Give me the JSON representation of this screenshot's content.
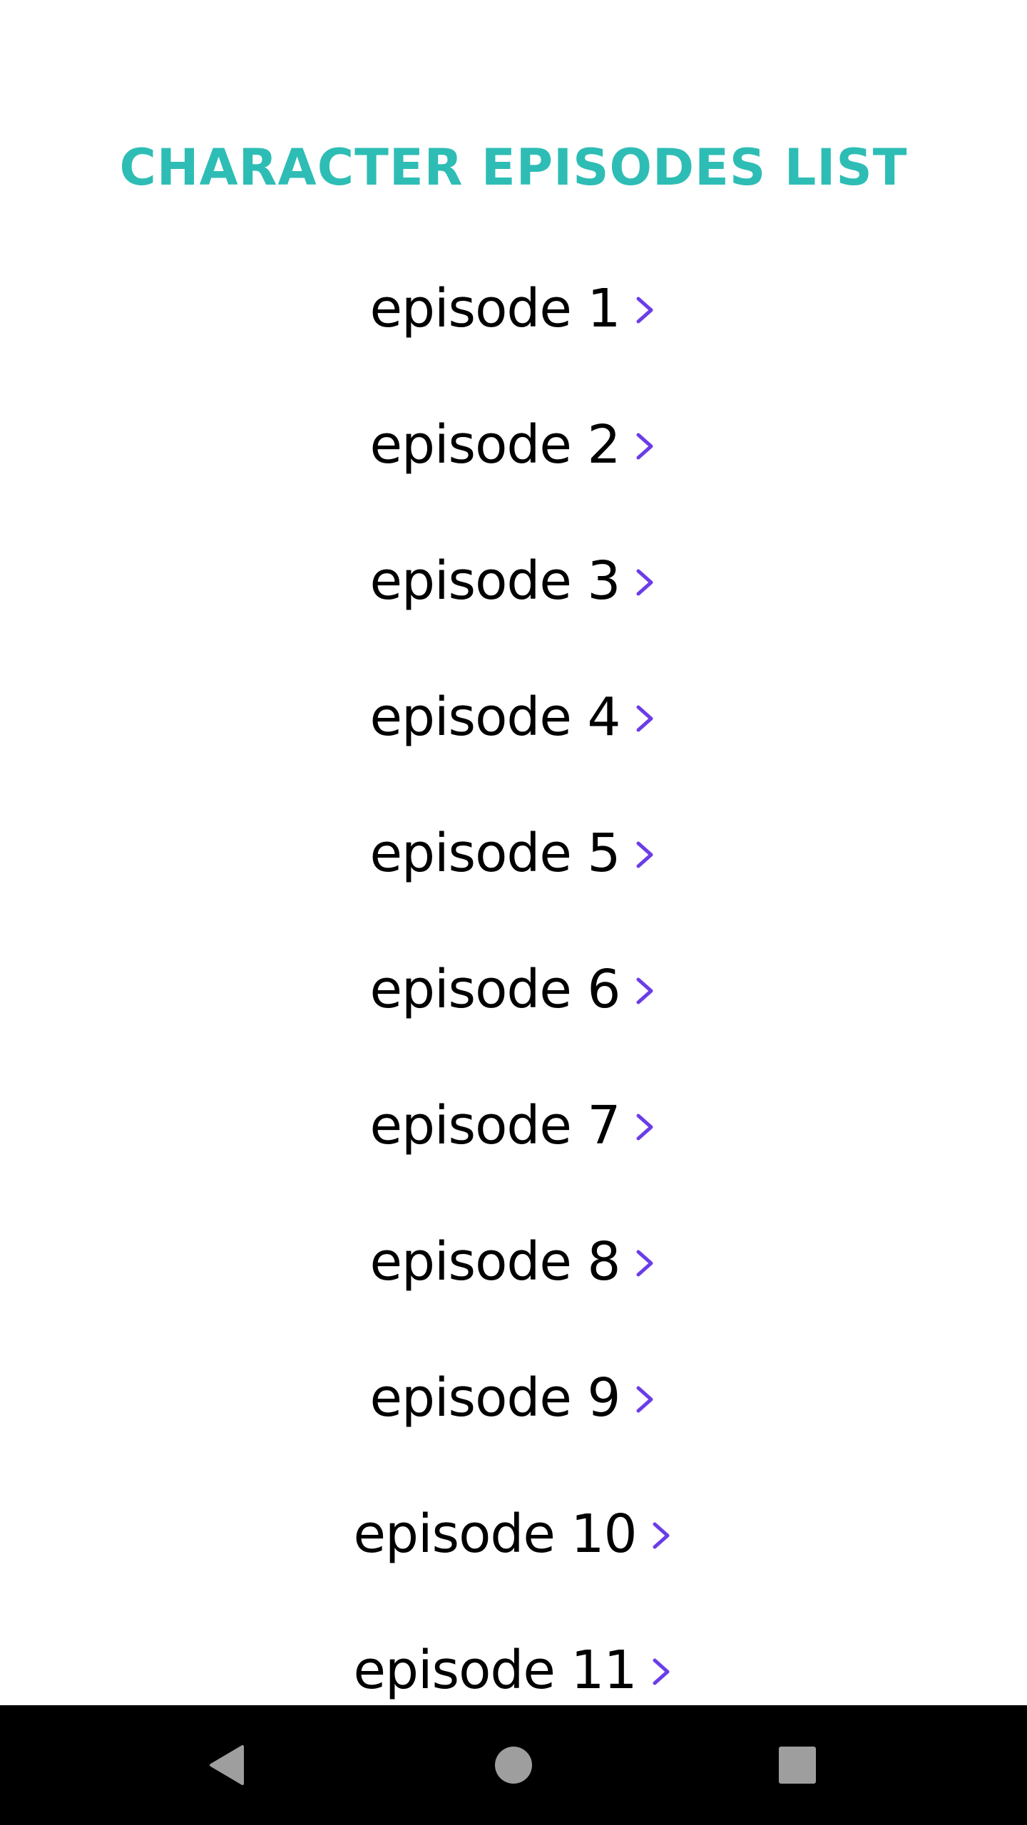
{
  "header": {
    "title": "Character Episodes List"
  },
  "episodes": [
    {
      "label": "episode 1"
    },
    {
      "label": "episode 2"
    },
    {
      "label": "episode 3"
    },
    {
      "label": "episode 4"
    },
    {
      "label": "episode 5"
    },
    {
      "label": "episode 6"
    },
    {
      "label": "episode 7"
    },
    {
      "label": "episode 8"
    },
    {
      "label": "episode 9"
    },
    {
      "label": "episode 10"
    },
    {
      "label": "episode 11"
    }
  ],
  "icons": {
    "row_trailing": "chevron-right-icon",
    "nav_back": "back-triangle-icon",
    "nav_home": "home-circle-icon",
    "nav_recents": "recents-square-icon"
  },
  "colors": {
    "title": "#2ebdb5",
    "chevron": "#6a3de8",
    "text": "#000000",
    "background": "#ffffff",
    "navbar": "#000000",
    "nav_icons": "#9e9e9e"
  }
}
